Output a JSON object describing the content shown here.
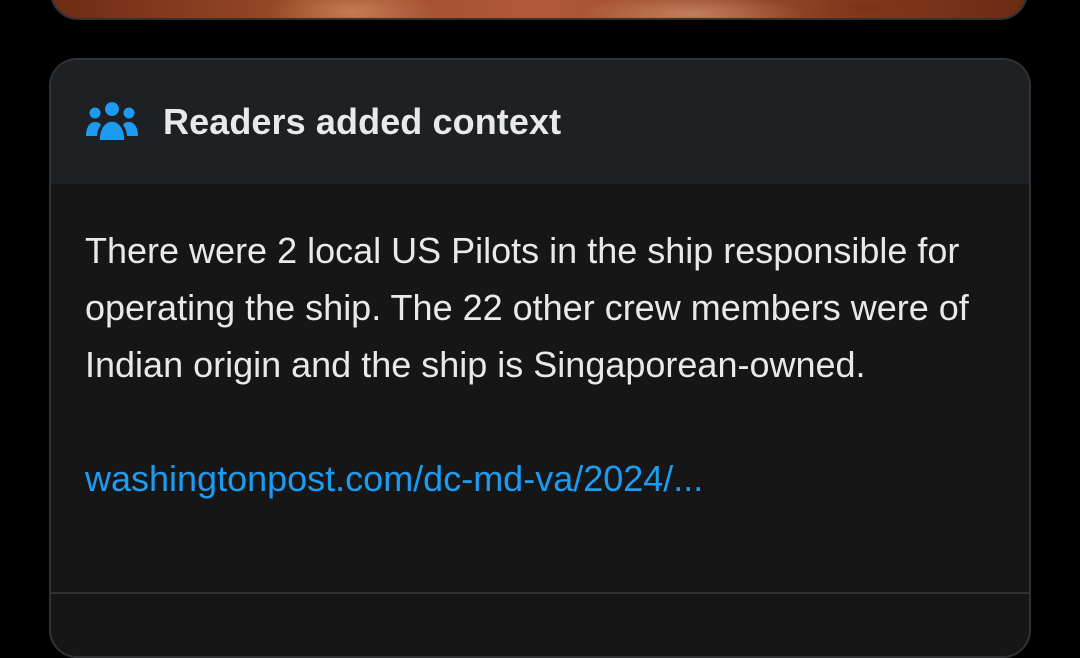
{
  "note": {
    "title": "Readers added context",
    "body": "There were 2 local US Pilots in the ship responsible for operating the ship. The 22 other crew members were of Indian origin and the ship is Singaporean-owned.",
    "link_text": "washingtonpost.com/dc-md-va/2024/...",
    "icon": "people-icon"
  },
  "colors": {
    "accent": "#1d9bf0",
    "text": "#e7e9ea",
    "card_bg": "#161616",
    "header_bg": "#1f2023",
    "border": "#2f3336",
    "page_bg": "#000000"
  }
}
